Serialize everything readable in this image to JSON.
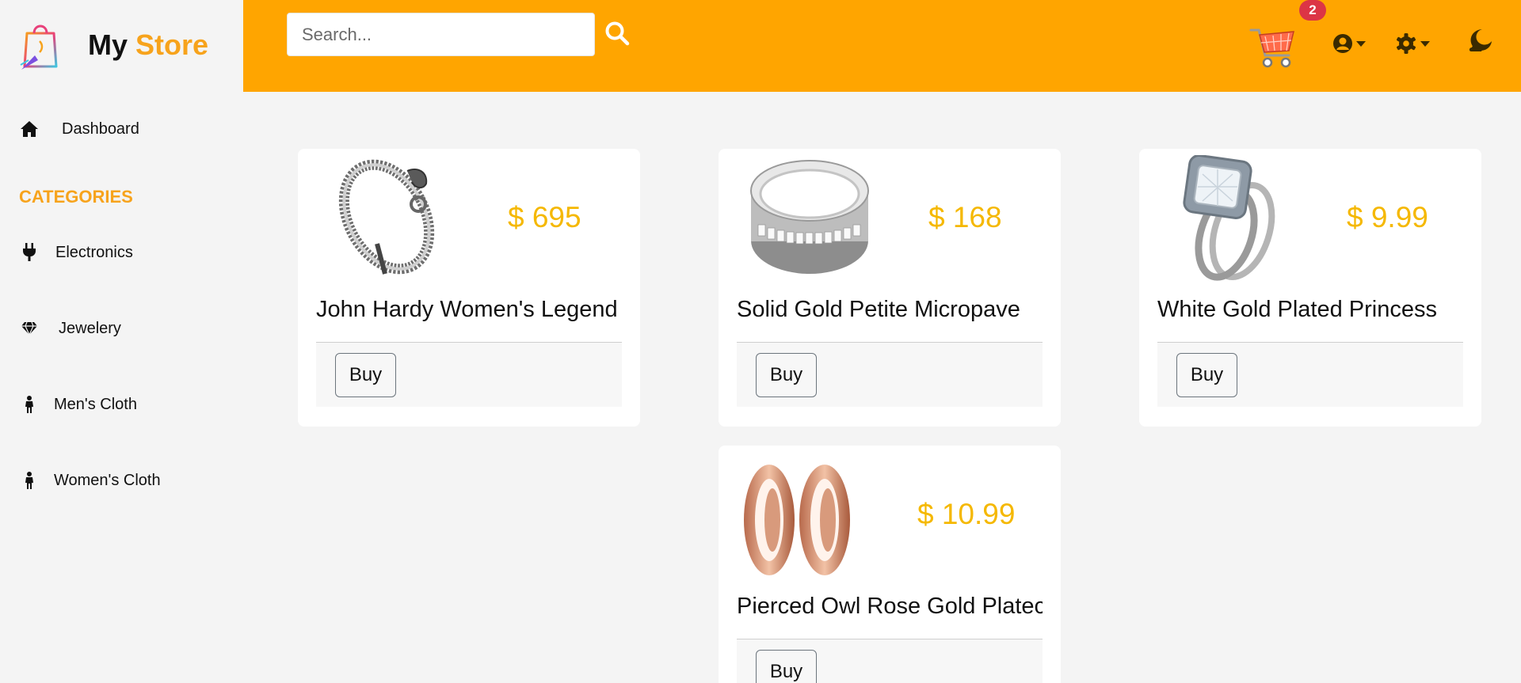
{
  "brand": {
    "name_part1": "My",
    "name_part2": "Store"
  },
  "search": {
    "placeholder": "Search..."
  },
  "header": {
    "cart_count": "2"
  },
  "sidebar": {
    "dashboard_label": "Dashboard",
    "categories_title": "CATEGORIES",
    "items": [
      {
        "label": "Electronics",
        "icon": "plug-icon"
      },
      {
        "label": "Jewelery",
        "icon": "gem-icon"
      },
      {
        "label": "Men's Cloth",
        "icon": "person-icon"
      },
      {
        "label": "Women's Cloth",
        "icon": "person-icon"
      }
    ]
  },
  "products": [
    {
      "price": "$ 695",
      "name": "John Hardy Women's Legend",
      "buy_label": "Buy",
      "image": "chain-bracelet"
    },
    {
      "price": "$ 168",
      "name": "Solid Gold Petite Micropave",
      "buy_label": "Buy",
      "image": "micropave-ring"
    },
    {
      "price": "$ 9.99",
      "name": "White Gold Plated Princess",
      "buy_label": "Buy",
      "image": "diamond-ring-set"
    },
    {
      "price": "$ 10.99",
      "name": "Pierced Owl Rose Gold Platec",
      "buy_label": "Buy",
      "image": "rose-gold-tunnels"
    }
  ],
  "colors": {
    "accent": "#ffa500",
    "brand_accent": "#f7a31c",
    "price": "#f5b800",
    "badge": "#dc3545"
  }
}
